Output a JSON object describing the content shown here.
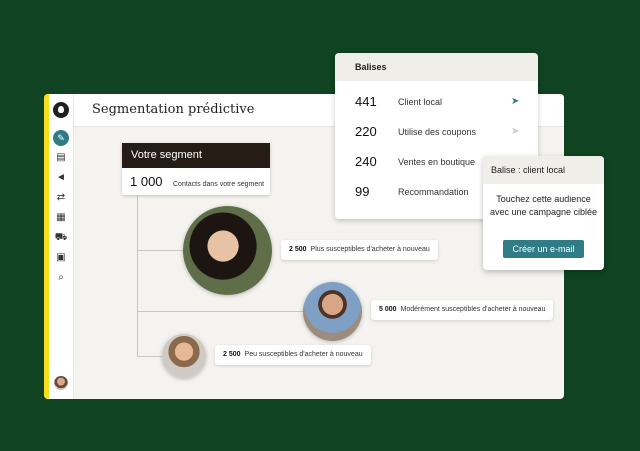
{
  "app": {
    "title": "Segmentation prédictive"
  },
  "sidebar": {
    "icons": [
      "mailchimp-logo-icon",
      "edit-icon",
      "contacts-icon",
      "campaigns-icon",
      "automations-icon",
      "website-icon",
      "integrations-icon",
      "grid-icon",
      "search-icon",
      "avatar"
    ]
  },
  "segment": {
    "title": "Votre segment",
    "count": "1 000",
    "count_label": "Contacts dans votre segment"
  },
  "branches": [
    {
      "count": "2 500",
      "label": "Plus susceptibles d'acheter à nouveau"
    },
    {
      "count": "5 000",
      "label": "Modérément susceptibles d'acheter à nouveau"
    },
    {
      "count": "2 500",
      "label": "Peu susceptibles d'acheter à nouveau"
    }
  ],
  "tags": {
    "title": "Balises",
    "rows": [
      {
        "count": "441",
        "name": "Client local",
        "icon": "send-icon"
      },
      {
        "count": "220",
        "name": "Utilise des coupons",
        "icon": "send-icon"
      },
      {
        "count": "240",
        "name": "Ventes en boutique",
        "icon": ""
      },
      {
        "count": "99",
        "name": "Recommandation",
        "icon": ""
      }
    ]
  },
  "popup": {
    "title": "Balise : client local",
    "text": "Touchez cette audience avec une campagne ciblée",
    "button": "Créer un e-mail"
  },
  "colors": {
    "background": "#0f4322",
    "accent": "#2f7c87",
    "sidebar_highlight": "#f7df1e",
    "segment_header": "#241c15"
  }
}
